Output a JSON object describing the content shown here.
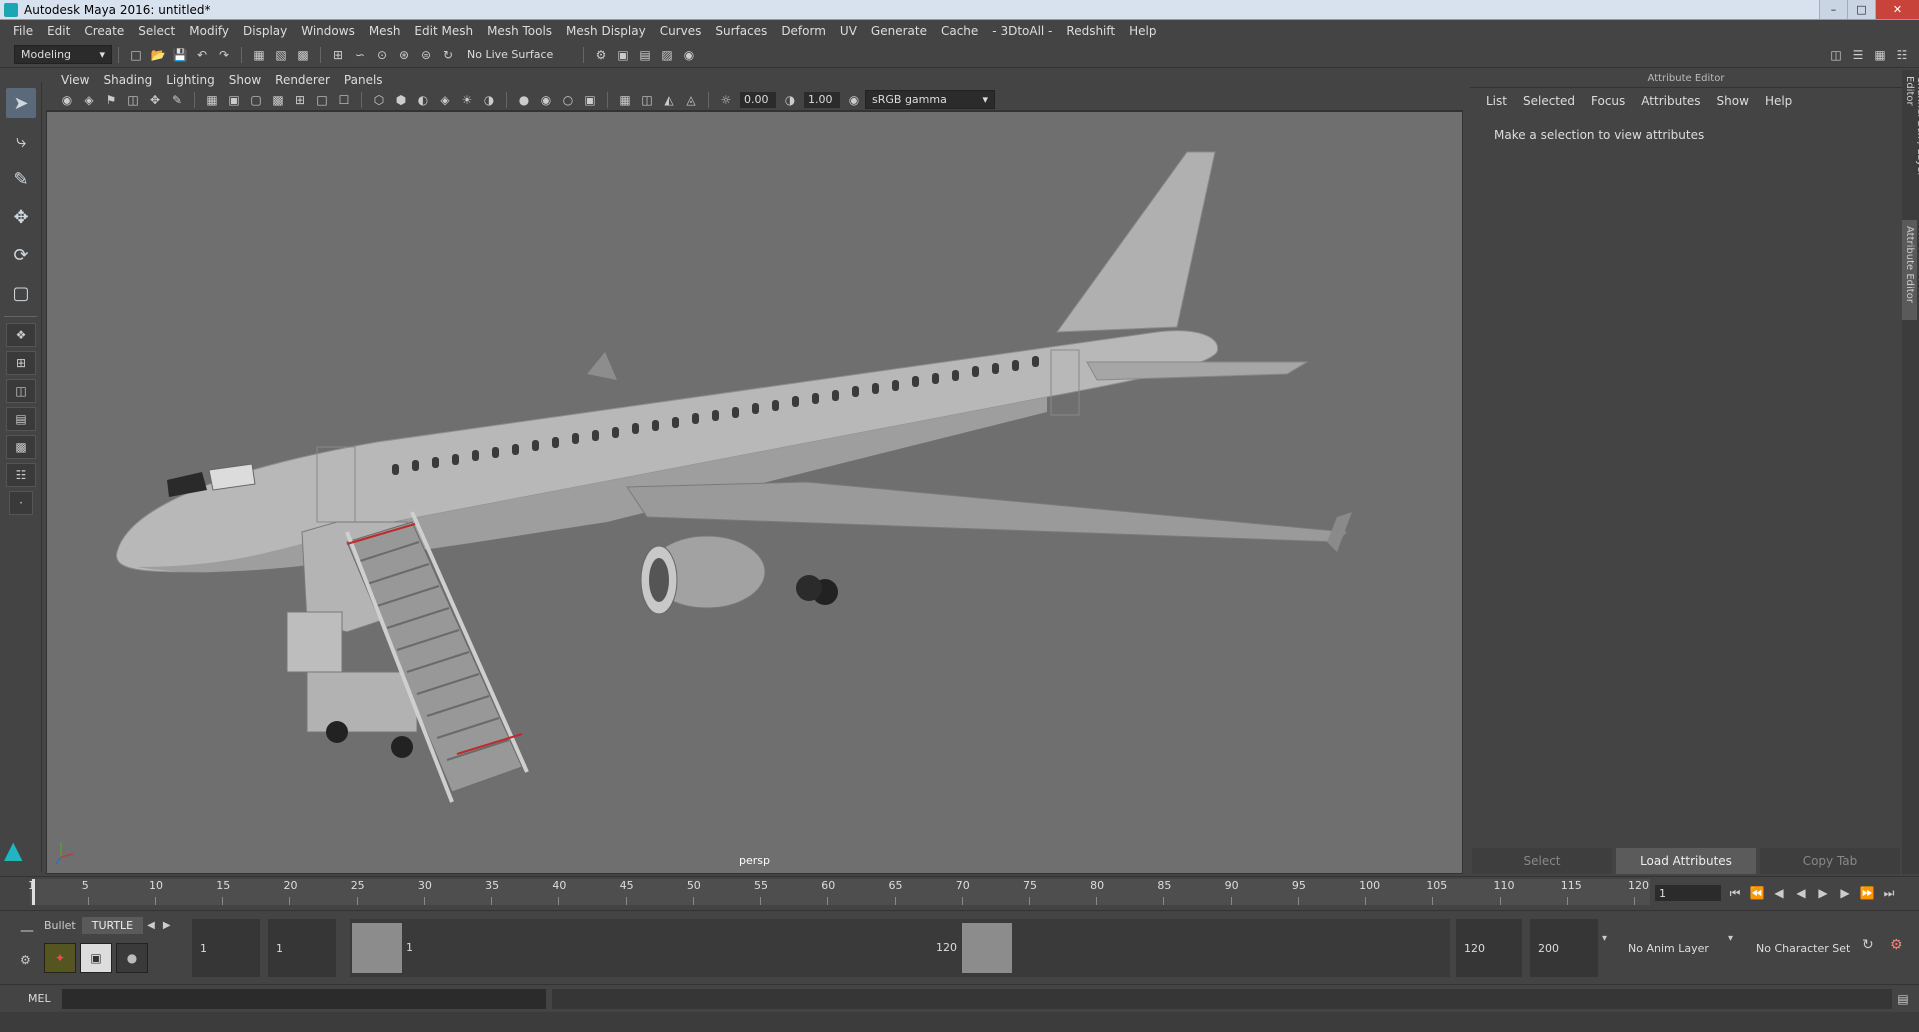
{
  "window": {
    "title": "Autodesk Maya 2016: untitled*"
  },
  "menu": [
    "File",
    "Edit",
    "Create",
    "Select",
    "Modify",
    "Display",
    "Windows",
    "Mesh",
    "Edit Mesh",
    "Mesh Tools",
    "Mesh Display",
    "Curves",
    "Surfaces",
    "Deform",
    "UV",
    "Generate",
    "Cache",
    "- 3DtoAll -",
    "Redshift",
    "Help"
  ],
  "toolbar": {
    "mode": "Modeling",
    "live_surface": "No Live Surface"
  },
  "viewport": {
    "menu": [
      "View",
      "Shading",
      "Lighting",
      "Show",
      "Renderer",
      "Panels"
    ],
    "exposure": "0.00",
    "gamma": "1.00",
    "color_space": "sRGB gamma",
    "camera": "persp"
  },
  "attribute_editor": {
    "title": "Attribute Editor",
    "tabs": [
      "List",
      "Selected",
      "Focus",
      "Attributes",
      "Show",
      "Help"
    ],
    "message": "Make a selection to view attributes",
    "buttons": [
      "Select",
      "Load Attributes",
      "Copy Tab"
    ]
  },
  "side_tabs": [
    "Channel Box / Layer Editor",
    "Attribute Editor"
  ],
  "timeline": {
    "ticks": [
      "1",
      "5",
      "10",
      "15",
      "20",
      "25",
      "30",
      "35",
      "40",
      "45",
      "50",
      "55",
      "60",
      "65",
      "70",
      "75",
      "80",
      "85",
      "90",
      "95",
      "100",
      "105",
      "110",
      "115",
      "120"
    ],
    "current_frame": "1"
  },
  "shelf": {
    "tabs": [
      "Bullet",
      "TURTLE"
    ]
  },
  "range": {
    "start": "1",
    "playback_start": "1",
    "slider_start": "1",
    "slider_end": "120",
    "playback_end": "120",
    "end": "200",
    "anim_layer": "No Anim Layer",
    "character_set": "No Character Set"
  },
  "command": {
    "language": "MEL"
  }
}
